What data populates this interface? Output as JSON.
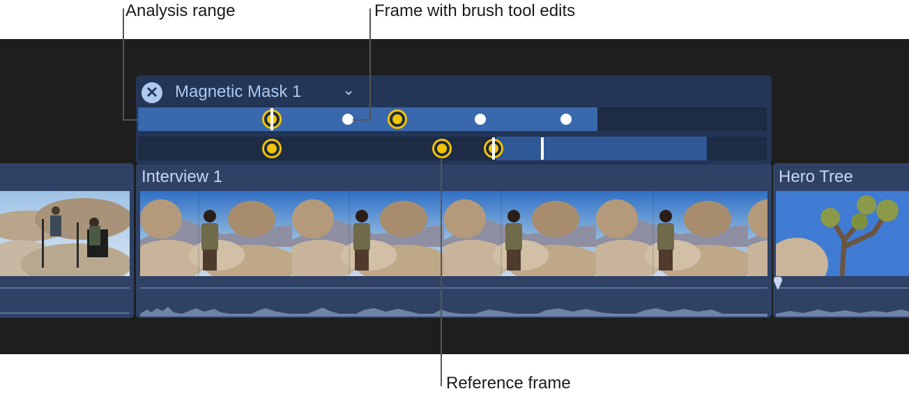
{
  "callouts": {
    "analysis_range": "Analysis range",
    "brush_frame": "Frame with brush tool edits",
    "reference_frame": "Reference frame"
  },
  "mask": {
    "title": "Magnetic Mask 1",
    "close_icon": "close-icon",
    "chevron_icon": "chevron-down-icon"
  },
  "clips": {
    "interview": {
      "title": "Interview 1"
    },
    "hero_tree": {
      "title": "Hero Tree"
    }
  },
  "colors": {
    "timeline_bg": "#1e1e1e",
    "clip_bg": "#2f4266",
    "mask_bg": "#233657",
    "analysis_fill": "#3a68ad",
    "keyframe_yellow": "#f5c400",
    "title_text": "#c9d7ef"
  }
}
